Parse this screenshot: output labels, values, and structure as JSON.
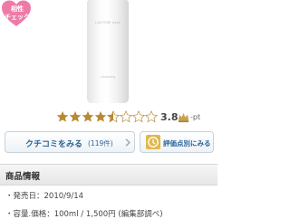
{
  "product": {
    "badge_text": "相性\nチェック",
    "bottle_label": "LACTOSE esse",
    "bottle_sub": "cleansing"
  },
  "rating": {
    "score": "3.8",
    "stars_filled_fraction": 0.54,
    "pt_label": "-pt",
    "star_color": "#b88a34"
  },
  "buttons": {
    "review_label": "クチコミをみる",
    "review_count": "(119件)",
    "rating_label": "評価点別にみる"
  },
  "info": {
    "header": "商品情報",
    "release_label": "・発売日：2010/9/14",
    "price_label": "・容量.価格：100ml / 1,500円 (編集部調べ)"
  }
}
